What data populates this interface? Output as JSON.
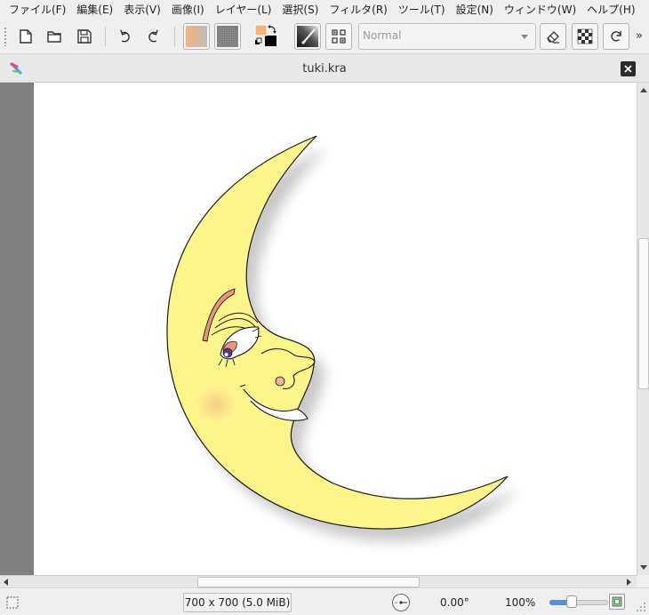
{
  "menu": [
    "ファイル(F)",
    "編集(E)",
    "表示(V)",
    "画像(I)",
    "レイヤー(L)",
    "選択(S)",
    "フィルタ(R)",
    "ツール(T)",
    "設定(N)",
    "ウィンドウ(W)",
    "ヘルプ(H)"
  ],
  "toolbar": {
    "blend_mode": "Normal",
    "more_label": "»",
    "icons": [
      "new-document-icon",
      "open-folder-icon",
      "save-icon",
      "undo-icon",
      "redo-icon",
      "gradient-preset-icon",
      "pattern-preset-icon",
      "fg-bg-color-icon",
      "brush-preset-icon",
      "brush-options-icon",
      "eraser-icon",
      "alpha-lock-icon",
      "reload-preset-icon"
    ],
    "colors": {
      "foreground": "#f6b27a",
      "background": "#000000"
    }
  },
  "document": {
    "title": "tuki.kra"
  },
  "canvas": {
    "colors": {
      "moon": "#fbf58a",
      "outline": "#1a1a1a",
      "shadow": "#c9c9c9",
      "cheek": "#f7c88a",
      "brow": "#e8967a",
      "iris": "#5a3c8c"
    }
  },
  "status": {
    "image_size": "700 x 700 (5.0 MiB)",
    "rotation": "0.00°",
    "zoom": "100%",
    "zoom_level": 0.35
  }
}
